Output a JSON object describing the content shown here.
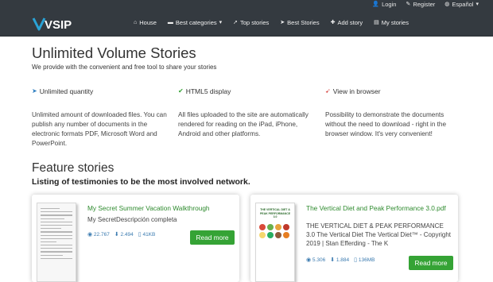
{
  "topbar": {
    "login": "Login",
    "register": "Register",
    "language": "Español",
    "colors": {
      "bar": "#343a40"
    }
  },
  "logo": {
    "text": "VSIP"
  },
  "nav": {
    "items": [
      {
        "label": "House",
        "icon": "home-icon"
      },
      {
        "label": "Best categories",
        "icon": "folder-icon"
      },
      {
        "label": "Top stories",
        "icon": "bookmark-icon"
      },
      {
        "label": "Best Stories",
        "icon": "paper-plane-icon"
      },
      {
        "label": "Add story",
        "icon": "plus-icon"
      },
      {
        "label": "My stories",
        "icon": "document-icon"
      }
    ]
  },
  "hero": {
    "title": "Unlimited Volume Stories",
    "subtitle": "We provide with the convenient and free tool to share your stories"
  },
  "features": [
    {
      "title": "Unlimited quantity",
      "icon": "send-icon",
      "text": "Unlimited amount of downloaded files. You can publish any number of documents in the electronic formats PDF, Microsoft Word and PowerPoint."
    },
    {
      "title": "HTML5 display",
      "icon": "check-icon",
      "text": "All files uploaded to the site are automatically rendered for reading on the iPad, iPhone, Android and other platforms."
    },
    {
      "title": "View in browser",
      "icon": "pin-icon",
      "text": "Possibility to demonstrate the documents without the need to download - right in the browser window. It's very convenient!"
    }
  ],
  "section": {
    "title": "Feature stories",
    "subtitle": "Listing of testimonies to be the most involved network."
  },
  "cards": [
    {
      "title": "My Secret Summer Vacation Walkthrough",
      "description": "My SecretDescripción completa",
      "views": "22.767",
      "downloads": "2.494",
      "size": "41KB",
      "button": "Read more"
    },
    {
      "title": "The Vertical Diet and Peak Performance 3.0.pdf",
      "description": "THE VERTICAL DIET & PEAK PERFORMANCE 3.0 The Vertical Diet The Vertical Diet™ - Copyright 2019 | Stan Efferding - The K",
      "views": "5.306",
      "downloads": "1.884",
      "size": "136MB",
      "button": "Read more",
      "thumb_title": "THE VERTICAL DIET & PEAK PERFORMANCE 3.0"
    }
  ],
  "colors": {
    "accent_green": "#35a335",
    "link_green": "#2d8a2d",
    "stat_blue": "#3b7bb0"
  }
}
